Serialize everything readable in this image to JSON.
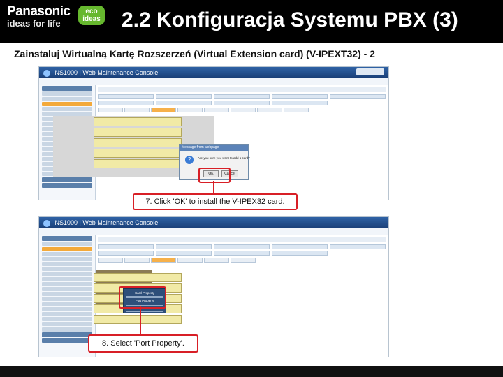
{
  "header": {
    "brand": "Panasonic",
    "tagline": "ideas for life",
    "eco_line1": "eco",
    "eco_line2": "ideas",
    "title": "2.2 Konfiguracja Systemu PBX (3)"
  },
  "subtitle": "Zainstaluj Wirtualną Kartę Rozszerzeń (Virtual Extension card) (V-IPEXT32) - 2",
  "screen1": {
    "app_title": "NS1000 | Web Maintenance Console",
    "dialog": {
      "title": "Message from webpage",
      "text": "Are you sure you want to add 1 card?",
      "ok": "OK",
      "cancel": "Cancel"
    },
    "callout": "7. Click 'OK' to install the V-IPEX32 card."
  },
  "screen2": {
    "app_title": "NS1000 | Web Maintenance Console",
    "menu": [
      "Card Property",
      "Port Property",
      "Cut"
    ],
    "callout": "8. Select 'Port Property'."
  },
  "colors": {
    "header_bg": "#000000",
    "eco_green": "#66b82e",
    "highlight_red": "#d81f26",
    "app_blue": "#2f62a5"
  }
}
